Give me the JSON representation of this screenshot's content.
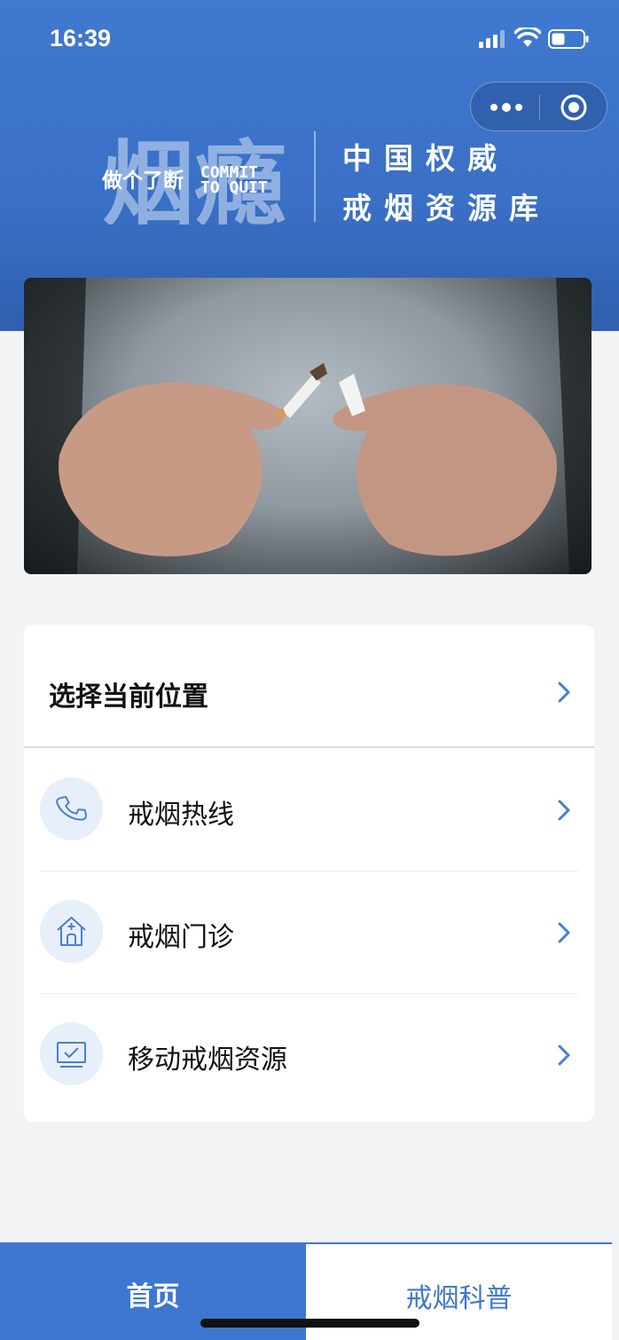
{
  "status_bar": {
    "time": "16:39"
  },
  "header": {
    "logo": {
      "big_chars": "烟瘾",
      "left_text": "做个了断",
      "right_text_line1": "COMMIT",
      "right_text_line2": "TO QUIT"
    },
    "slogan_line1": "中国权威",
    "slogan_line2": "戒烟资源库"
  },
  "menu": {
    "location_label": "选择当前位置",
    "items": [
      {
        "label": "戒烟热线",
        "icon": "phone-icon"
      },
      {
        "label": "戒烟门诊",
        "icon": "clinic-icon"
      },
      {
        "label": "移动戒烟资源",
        "icon": "monitor-icon"
      }
    ]
  },
  "tabbar": {
    "home_label": "首页",
    "science_label": "戒烟科普"
  },
  "colors": {
    "primary": "#3d77cf",
    "icon_bg": "#e7effa"
  }
}
